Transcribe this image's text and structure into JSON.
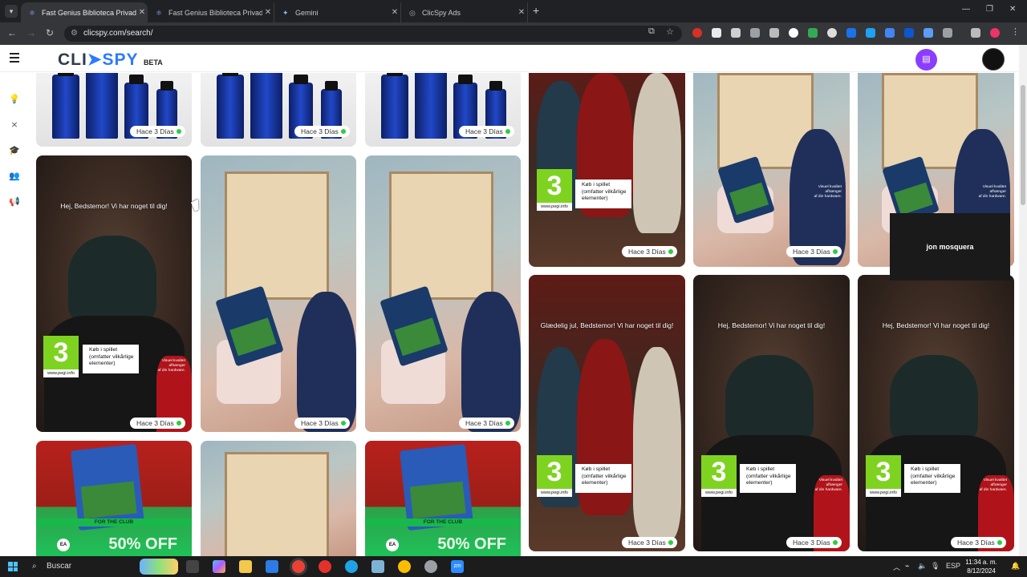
{
  "browser": {
    "tabs": [
      {
        "label": "Fast Genius Biblioteca Privada",
        "active": true
      },
      {
        "label": "Fast Genius Biblioteca Privada",
        "active": false
      },
      {
        "label": "Gemini",
        "active": false
      },
      {
        "label": "ClicSpy Ads",
        "active": false
      }
    ],
    "url": "clicspy.com/search/"
  },
  "app": {
    "logo_left": "CLI",
    "logo_right": "SPY",
    "logo_badge": "BETA"
  },
  "cards": {
    "age_badge": "Hace 3 Días",
    "caption_hej": "Hej, Bedstemor! Vi har noget til dig!",
    "caption_jul": "Glædelig jul, Bedstemor! Vi har noget til dig!",
    "pegi_number": "3",
    "pegi_site": "www.pegi.info",
    "kob_line1": "Køb i spillet",
    "kob_line2": "(omfatter vilkårlige",
    "kob_line3": "elementer)",
    "visuel_line1": "Visuel kvalitet",
    "visuel_line2": "afhænger",
    "visuel_line3": "af din hardware.",
    "fc_band": "FOR THE CLUB",
    "off_text": "50% OFF",
    "ea_logo": "EA"
  },
  "tooltip": {
    "text": "jon mosquera"
  },
  "taskbar": {
    "search_label": "Buscar",
    "language": "ESP",
    "time": "11:34 a. m.",
    "date": "8/12/2024"
  },
  "colors": {
    "accent_purple": "#8b3dff",
    "logo_blue": "#2b7bff",
    "badge_dot": "#2ecc40",
    "pegi_green": "#7ed321"
  }
}
